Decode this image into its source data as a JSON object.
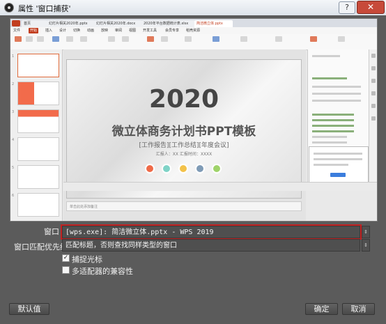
{
  "window": {
    "title": "属性 '窗口捕获'",
    "help_label": "?",
    "close_label": "✕",
    "icon": "obs-app-icon"
  },
  "preview": {
    "tabs": [
      "首页",
      "幻灯片相关2020年.pptx",
      "幻灯片相关2020年.docx",
      "2020年平台数据统计表.xlsx",
      "简洁微立体.pptx"
    ],
    "menu": [
      "文件",
      "开始",
      "插入",
      "设计",
      "切换",
      "动画",
      "放映",
      "审阅",
      "视图",
      "开发工具",
      "会员专享",
      "稻壳资源"
    ],
    "slide_numbers": [
      "1",
      "2",
      "3",
      "4",
      "5",
      "6"
    ],
    "slide": {
      "year": "2020",
      "title": "微立体商务计划书PPT模板",
      "subtitle": "[工作报告][工作总结][年度会议]",
      "presenter": "汇报人：XX    汇报时间：XXXX"
    },
    "notes_placeholder": "单击此处添加备注",
    "dot_colors": [
      "#ef6a48",
      "#7fd3c7",
      "#f3c24a",
      "#7f9bb6",
      "#9fd36a"
    ]
  },
  "form": {
    "window_label": "窗口",
    "window_value": "[wps.exe]: 简洁微立体.pptx - WPS 2019",
    "priority_label": "窗口匹配优先级",
    "priority_value": "匹配标题，否则查找同样类型的窗口",
    "capture_cursor_label": "捕捉光标",
    "capture_cursor_checked": true,
    "multi_adapter_label": "多适配器的兼容性",
    "multi_adapter_checked": false
  },
  "buttons": {
    "defaults": "默认值",
    "ok": "确定",
    "cancel": "取消"
  },
  "colors": {
    "highlight_outline": "#c32222",
    "dialog_bg": "#5b5b5b",
    "wps_accent": "#c23d1e"
  }
}
